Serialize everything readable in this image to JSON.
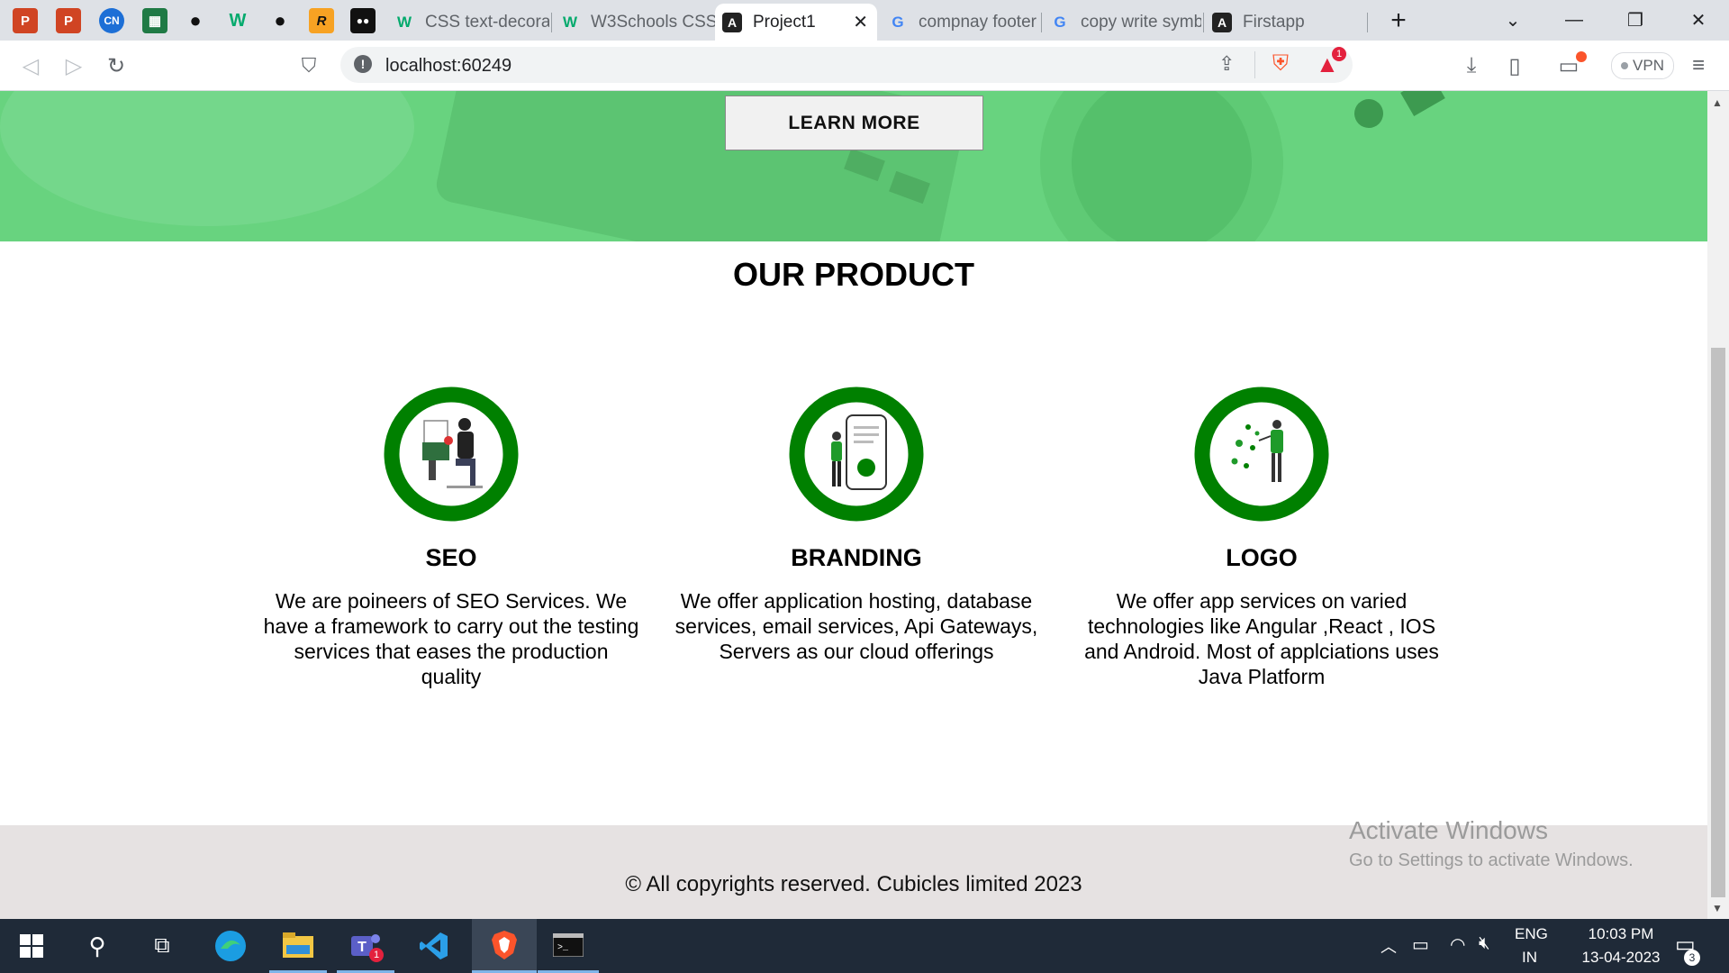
{
  "browser": {
    "tabs": [
      {
        "label": "CSS text-decora",
        "favicon": "w3schools-icon"
      },
      {
        "label": "W3Schools CSS",
        "favicon": "w3schools-icon"
      },
      {
        "label": "Project1",
        "favicon": "angular-icon"
      },
      {
        "label": "compnay footer",
        "favicon": "google-icon"
      },
      {
        "label": "copy write symb",
        "favicon": "google-icon"
      },
      {
        "label": "Firstapp",
        "favicon": "angular-icon"
      }
    ],
    "url": "localhost:60249",
    "notification_badge": "1",
    "vpn_label": "VPN"
  },
  "hero": {
    "button_label": "LEARN MORE"
  },
  "products": {
    "title": "OUR PRODUCT",
    "items": [
      {
        "title": "SEO",
        "description": "We are poineers of SEO Services. We have a framework to carry out the testing services that eases the production quality"
      },
      {
        "title": "BRANDING",
        "description": "We offer application hosting, database services, email services, Api Gateways, Servers as our cloud offerings"
      },
      {
        "title": "LOGO",
        "description": "We offer app services on varied technologies like Angular ,React , IOS and Android. Most of applciations uses Java Platform"
      }
    ]
  },
  "footer": {
    "copyright": "© All copyrights reserved. Cubicles limited 2023"
  },
  "watermark": {
    "line1": "Activate Windows",
    "line2": "Go to Settings to activate Windows."
  },
  "taskbar": {
    "lang1": "ENG",
    "lang2": "IN",
    "time": "10:03 PM",
    "date": "13-04-2023",
    "teams_badge": "1",
    "notif_count": "3"
  },
  "colors": {
    "accent_green": "#008000",
    "hero_green": "#68d37f",
    "footer_bg": "#e6e2e2"
  }
}
